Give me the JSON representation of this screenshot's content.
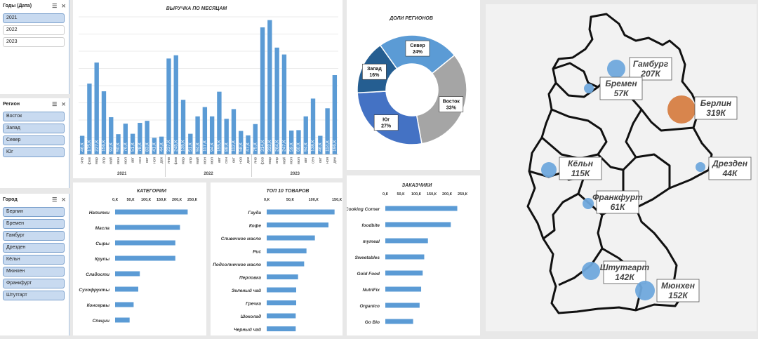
{
  "slicers": {
    "years": {
      "title": "Годы (Дата)",
      "items": [
        {
          "label": "2021",
          "selected": true
        },
        {
          "label": "2022",
          "selected": false
        },
        {
          "label": "2023",
          "selected": false
        }
      ]
    },
    "region": {
      "title": "Регион",
      "items": [
        {
          "label": "Восток",
          "selected": true
        },
        {
          "label": "Запад",
          "selected": true
        },
        {
          "label": "Север",
          "selected": true
        },
        {
          "label": "Юг",
          "selected": true
        }
      ]
    },
    "city": {
      "title": "Город",
      "items": [
        {
          "label": "Берлин",
          "selected": true
        },
        {
          "label": "Бремен",
          "selected": true
        },
        {
          "label": "Гамбург",
          "selected": true
        },
        {
          "label": "Дрезден",
          "selected": true
        },
        {
          "label": "Кёльн",
          "selected": true
        },
        {
          "label": "Мюнхен",
          "selected": true
        },
        {
          "label": "Франкфурт",
          "selected": true
        },
        {
          "label": "Штутгарт",
          "selected": true
        }
      ]
    }
  },
  "colors": {
    "bar": "#5b9bd5",
    "pie_north": "#5b9bd5",
    "pie_east": "#a5a5a5",
    "pie_south": "#4472c4",
    "pie_west": "#255e91",
    "bubble_blue": "#6fa8dc",
    "bubble_orange": "#d67e43"
  },
  "chart_data": [
    {
      "type": "bar",
      "title": "ВЫРУЧКА ПО МЕСЯЦАМ",
      "months": [
        "янв",
        "фев",
        "мар",
        "апр",
        "май",
        "июн",
        "июл",
        "авг",
        "сен",
        "окт",
        "ноя",
        "дек"
      ],
      "years": [
        "2021",
        "2022",
        "2023"
      ],
      "values": [
        46,
        175,
        227,
        156,
        92,
        50,
        76,
        51,
        78,
        83,
        41,
        44,
        237,
        245,
        135,
        51,
        94,
        117,
        94,
        155,
        88,
        112,
        58,
        47,
        75,
        314,
        332,
        264,
        247,
        59,
        60,
        94,
        138,
        46,
        114,
        196
      ],
      "labels": [
        "46,К",
        "175,К",
        "227,К",
        "156,К",
        "92,К",
        "50,К",
        "76,К",
        "51,К",
        "78,К",
        "83,К",
        "41,К",
        "44,К",
        "237,К",
        "245,К",
        "135,К",
        "51,К",
        "94,К",
        "117,К",
        "94,К",
        "155,К",
        "88,К",
        "112,К",
        "58,К",
        "47,К",
        "75,К",
        "314,К",
        "332,К",
        "264,К",
        "247,К",
        "59,К",
        "60,К",
        "94,К",
        "138,К",
        "46,К",
        "114,К",
        "196,К"
      ],
      "ylim": [
        0,
        340
      ]
    },
    {
      "type": "pie",
      "title": "ДОЛИ РЕГИОНОВ",
      "slices": [
        {
          "name": "Север",
          "value": 24,
          "label": "24%"
        },
        {
          "name": "Восток",
          "value": 33,
          "label": "33%"
        },
        {
          "name": "Юг",
          "value": 27,
          "label": "27%"
        },
        {
          "name": "Запад",
          "value": 16,
          "label": "16%"
        }
      ]
    },
    {
      "type": "bar",
      "title": "КАТЕГОРИИ",
      "orientation": "horizontal",
      "ticks": [
        "0,К",
        "50,К",
        "100,К",
        "150,К",
        "200,К",
        "250,К"
      ],
      "xlim": [
        0,
        250
      ],
      "categories": [
        "Напитки",
        "Масла",
        "Сыры",
        "Крупы",
        "Сладости",
        "Сухофрукты",
        "Консервы",
        "Специи"
      ],
      "values": [
        235,
        210,
        195,
        195,
        80,
        75,
        60,
        47
      ]
    },
    {
      "type": "bar",
      "title": "ТОП 10 ТОВАРОВ",
      "orientation": "horizontal",
      "ticks": [
        "0,К",
        "50,К",
        "100,К",
        "150,К"
      ],
      "xlim": [
        0,
        150
      ],
      "categories": [
        "Гауда",
        "Кофе",
        "Сливочное масло",
        "Рис",
        "Подсолнечное масло",
        "Перловка",
        "Зеленый чай",
        "Гречка",
        "Шоколад",
        "Черный чай"
      ],
      "values": [
        145,
        132,
        103,
        85,
        80,
        67,
        63,
        63,
        62,
        62
      ]
    },
    {
      "type": "bar",
      "title": "ЗАКАЗЧИКИ",
      "orientation": "horizontal",
      "ticks": [
        "0,К",
        "50,К",
        "100,К",
        "150,К",
        "200,К",
        "250,К"
      ],
      "xlim": [
        0,
        250
      ],
      "categories": [
        "Cooking Corner",
        "foodbite",
        "mymeal",
        "Sweetables",
        "Gold Food",
        "NutriFix",
        "Organico",
        "Go Bio"
      ],
      "values": [
        233,
        212,
        138,
        126,
        121,
        116,
        111,
        90
      ]
    }
  ],
  "map": {
    "cities": [
      {
        "name": "Гамбург",
        "value": "207К",
        "color": "blue"
      },
      {
        "name": "Бремен",
        "value": "57К",
        "color": "blue"
      },
      {
        "name": "Берлин",
        "value": "319К",
        "color": "orange"
      },
      {
        "name": "Кёльн",
        "value": "115К",
        "color": "blue"
      },
      {
        "name": "Дрезден",
        "value": "44К",
        "color": "blue"
      },
      {
        "name": "Франкфурт",
        "value": "61К",
        "color": "blue"
      },
      {
        "name": "Штутгарт",
        "value": "142К",
        "color": "blue"
      },
      {
        "name": "Мюнхен",
        "value": "152К",
        "color": "blue"
      }
    ]
  }
}
